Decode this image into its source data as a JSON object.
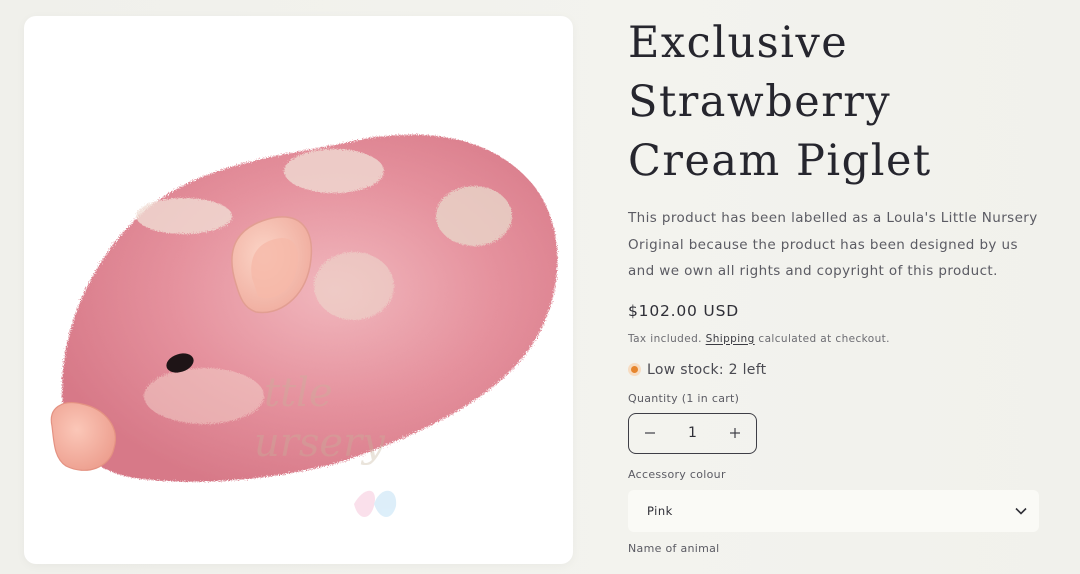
{
  "product": {
    "title": "Exclusive Strawberry Cream Piglet",
    "description": "This product has been labelled as a Loula's Little Nursery Original because the product has been designed by us and we own all rights and copyright of this product.",
    "price": "$102.00 USD",
    "tax_prefix": "Tax included.",
    "tax_link": "Shipping",
    "tax_suffix": "calculated at checkout.",
    "stock_text": "Low stock: 2 left",
    "image_alt": "Exclusive Strawberry Cream Piglet",
    "watermark_text": "Loula's Little Nursery"
  },
  "quantity": {
    "label": "Quantity (1 in cart)",
    "value": "1",
    "decrease_icon": "minus-icon",
    "increase_icon": "plus-icon"
  },
  "accessory": {
    "label": "Accessory colour",
    "selected": "Pink",
    "dropdown_icon": "chevron-down-icon"
  },
  "name_field": {
    "label": "Name of animal"
  },
  "colors": {
    "background": "#f1f1ec",
    "text": "#2f2f37",
    "stock_dot": "#e6852d",
    "piglet_pink": "#e8909c"
  }
}
